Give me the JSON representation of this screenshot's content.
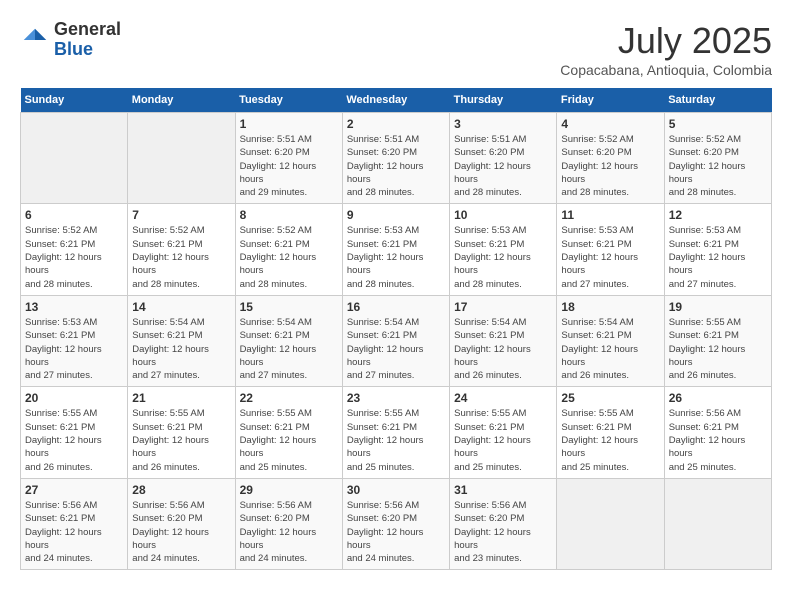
{
  "header": {
    "logo": {
      "general": "General",
      "blue": "Blue"
    },
    "title": "July 2025",
    "location": "Copacabana, Antioquia, Colombia"
  },
  "weekdays": [
    "Sunday",
    "Monday",
    "Tuesday",
    "Wednesday",
    "Thursday",
    "Friday",
    "Saturday"
  ],
  "weeks": [
    [
      {
        "day": null
      },
      {
        "day": null
      },
      {
        "day": 1,
        "sunrise": "5:51 AM",
        "sunset": "6:20 PM",
        "daylight": "12 hours and 29 minutes."
      },
      {
        "day": 2,
        "sunrise": "5:51 AM",
        "sunset": "6:20 PM",
        "daylight": "12 hours and 28 minutes."
      },
      {
        "day": 3,
        "sunrise": "5:51 AM",
        "sunset": "6:20 PM",
        "daylight": "12 hours and 28 minutes."
      },
      {
        "day": 4,
        "sunrise": "5:52 AM",
        "sunset": "6:20 PM",
        "daylight": "12 hours and 28 minutes."
      },
      {
        "day": 5,
        "sunrise": "5:52 AM",
        "sunset": "6:20 PM",
        "daylight": "12 hours and 28 minutes."
      }
    ],
    [
      {
        "day": 6,
        "sunrise": "5:52 AM",
        "sunset": "6:21 PM",
        "daylight": "12 hours and 28 minutes."
      },
      {
        "day": 7,
        "sunrise": "5:52 AM",
        "sunset": "6:21 PM",
        "daylight": "12 hours and 28 minutes."
      },
      {
        "day": 8,
        "sunrise": "5:52 AM",
        "sunset": "6:21 PM",
        "daylight": "12 hours and 28 minutes."
      },
      {
        "day": 9,
        "sunrise": "5:53 AM",
        "sunset": "6:21 PM",
        "daylight": "12 hours and 28 minutes."
      },
      {
        "day": 10,
        "sunrise": "5:53 AM",
        "sunset": "6:21 PM",
        "daylight": "12 hours and 28 minutes."
      },
      {
        "day": 11,
        "sunrise": "5:53 AM",
        "sunset": "6:21 PM",
        "daylight": "12 hours and 27 minutes."
      },
      {
        "day": 12,
        "sunrise": "5:53 AM",
        "sunset": "6:21 PM",
        "daylight": "12 hours and 27 minutes."
      }
    ],
    [
      {
        "day": 13,
        "sunrise": "5:53 AM",
        "sunset": "6:21 PM",
        "daylight": "12 hours and 27 minutes."
      },
      {
        "day": 14,
        "sunrise": "5:54 AM",
        "sunset": "6:21 PM",
        "daylight": "12 hours and 27 minutes."
      },
      {
        "day": 15,
        "sunrise": "5:54 AM",
        "sunset": "6:21 PM",
        "daylight": "12 hours and 27 minutes."
      },
      {
        "day": 16,
        "sunrise": "5:54 AM",
        "sunset": "6:21 PM",
        "daylight": "12 hours and 27 minutes."
      },
      {
        "day": 17,
        "sunrise": "5:54 AM",
        "sunset": "6:21 PM",
        "daylight": "12 hours and 26 minutes."
      },
      {
        "day": 18,
        "sunrise": "5:54 AM",
        "sunset": "6:21 PM",
        "daylight": "12 hours and 26 minutes."
      },
      {
        "day": 19,
        "sunrise": "5:55 AM",
        "sunset": "6:21 PM",
        "daylight": "12 hours and 26 minutes."
      }
    ],
    [
      {
        "day": 20,
        "sunrise": "5:55 AM",
        "sunset": "6:21 PM",
        "daylight": "12 hours and 26 minutes."
      },
      {
        "day": 21,
        "sunrise": "5:55 AM",
        "sunset": "6:21 PM",
        "daylight": "12 hours and 26 minutes."
      },
      {
        "day": 22,
        "sunrise": "5:55 AM",
        "sunset": "6:21 PM",
        "daylight": "12 hours and 25 minutes."
      },
      {
        "day": 23,
        "sunrise": "5:55 AM",
        "sunset": "6:21 PM",
        "daylight": "12 hours and 25 minutes."
      },
      {
        "day": 24,
        "sunrise": "5:55 AM",
        "sunset": "6:21 PM",
        "daylight": "12 hours and 25 minutes."
      },
      {
        "day": 25,
        "sunrise": "5:55 AM",
        "sunset": "6:21 PM",
        "daylight": "12 hours and 25 minutes."
      },
      {
        "day": 26,
        "sunrise": "5:56 AM",
        "sunset": "6:21 PM",
        "daylight": "12 hours and 25 minutes."
      }
    ],
    [
      {
        "day": 27,
        "sunrise": "5:56 AM",
        "sunset": "6:21 PM",
        "daylight": "12 hours and 24 minutes."
      },
      {
        "day": 28,
        "sunrise": "5:56 AM",
        "sunset": "6:20 PM",
        "daylight": "12 hours and 24 minutes."
      },
      {
        "day": 29,
        "sunrise": "5:56 AM",
        "sunset": "6:20 PM",
        "daylight": "12 hours and 24 minutes."
      },
      {
        "day": 30,
        "sunrise": "5:56 AM",
        "sunset": "6:20 PM",
        "daylight": "12 hours and 24 minutes."
      },
      {
        "day": 31,
        "sunrise": "5:56 AM",
        "sunset": "6:20 PM",
        "daylight": "12 hours and 23 minutes."
      },
      {
        "day": null
      },
      {
        "day": null
      }
    ]
  ]
}
